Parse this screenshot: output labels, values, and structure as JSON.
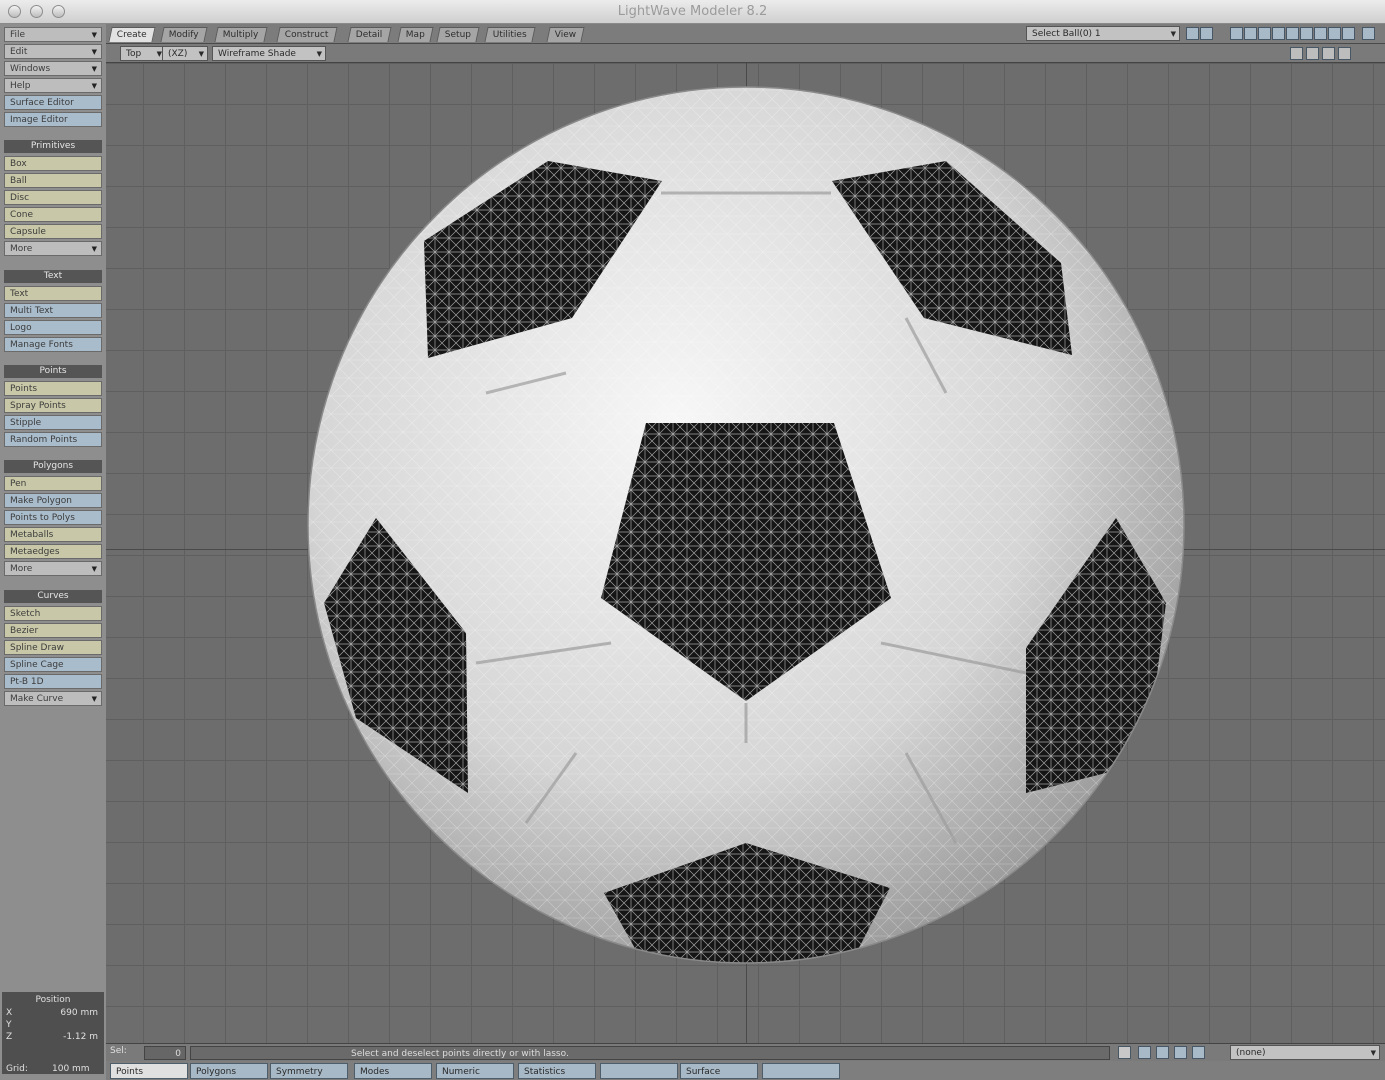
{
  "window": {
    "title": "LightWave Modeler 8.2"
  },
  "left_toolbar": {
    "menus": [
      "File",
      "Edit",
      "Windows",
      "Help"
    ],
    "editors": [
      "Surface Editor",
      "Image Editor"
    ],
    "sections": [
      {
        "title": "Primitives",
        "items": [
          "Box",
          "Ball",
          "Disc",
          "Cone",
          "Capsule",
          "More"
        ]
      },
      {
        "title": "Text",
        "items": [
          "Text",
          "Multi Text",
          "Logo",
          "Manage Fonts"
        ]
      },
      {
        "title": "Points",
        "items": [
          "Points",
          "Spray Points",
          "Stipple",
          "Random Points"
        ]
      },
      {
        "title": "Polygons",
        "items": [
          "Pen",
          "Make Polygon",
          "Points to Polys",
          "Metaballs",
          "Metaedges",
          "More"
        ]
      },
      {
        "title": "Curves",
        "items": [
          "Sketch",
          "Bezier",
          "Spline Draw",
          "Spline Cage",
          "Pt-B 1D",
          "Make Curve"
        ]
      }
    ],
    "position": {
      "title": "Position",
      "x_label": "X",
      "x_value": "690 mm",
      "y_label": "Y",
      "z_label": "Z",
      "z_value": "-1.12 m"
    }
  },
  "tabs": [
    "Create",
    "Modify",
    "Multiply",
    "Construct",
    "Detail",
    "Map",
    "Setup",
    "Utilities",
    "View"
  ],
  "active_tab": "Create",
  "top_right": {
    "layer_select": "Select Ball(0) 1"
  },
  "viewbar": {
    "view": "Top",
    "xyz": "(XZ)",
    "render_mode": "Wireframe Shade"
  },
  "status": {
    "sel_label": "Sel:",
    "sel_value": "0",
    "message": "Select and deselect points directly or with lasso.",
    "mode": "(none)"
  },
  "bottom": {
    "grid_label": "Grid:",
    "grid_value": "100 mm",
    "buttons": [
      "Points",
      "Polygons",
      "Symmetry",
      "Modes",
      "Numeric",
      "Statistics",
      "Surface"
    ]
  },
  "colors": {
    "panel": "#8e8e8e",
    "item": "#c8c8a8",
    "item_blue": "#a9bccb",
    "viewport": "#6d6d6d",
    "grid": "#5f5f5f"
  }
}
